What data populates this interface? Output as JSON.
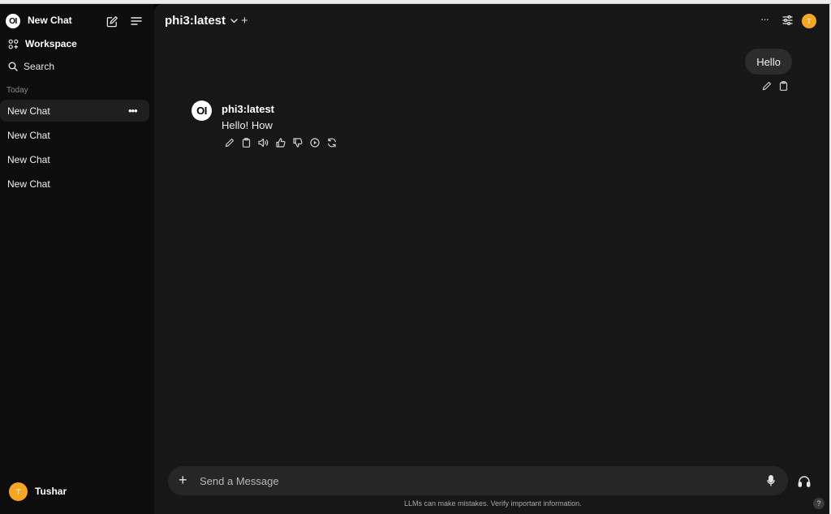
{
  "sidebar": {
    "brand_logo_text": "OI",
    "new_chat_label": "New Chat",
    "workspace_label": "Workspace",
    "search_label": "Search",
    "section_label": "Today",
    "chats": [
      "New Chat",
      "New Chat",
      "New Chat",
      "New Chat"
    ],
    "user": {
      "initial": "T",
      "name": "Tushar"
    }
  },
  "header": {
    "model": "phi3:latest",
    "add_symbol": "+",
    "more_symbol": "···",
    "avatar_initial": "T"
  },
  "conversation": {
    "user_message": "Hello",
    "assistant": {
      "logo_text": "OI",
      "name": "phi3:latest",
      "message": "Hello! How"
    }
  },
  "composer": {
    "plus_symbol": "+",
    "placeholder": "Send a Message",
    "disclaimer": "LLMs can make mistakes. Verify important information.",
    "help_symbol": "?"
  },
  "icons": {
    "sidebar": [
      "pencil-square-icon",
      "menu-lines-icon",
      "workspace-grid-icon",
      "magnifier-icon"
    ],
    "message_actions": [
      "pencil-icon",
      "clipboard-icon",
      "speaker-icon",
      "thumbs-up-icon",
      "thumbs-down-icon",
      "play-circle-icon",
      "refresh-icon"
    ]
  },
  "colors": {
    "sidebar_bg": "#0d0d0d",
    "main_bg": "#171717",
    "bubble_bg": "#2c2c2c",
    "composer_bg": "#262626",
    "avatar_orange": "#f5a623"
  }
}
